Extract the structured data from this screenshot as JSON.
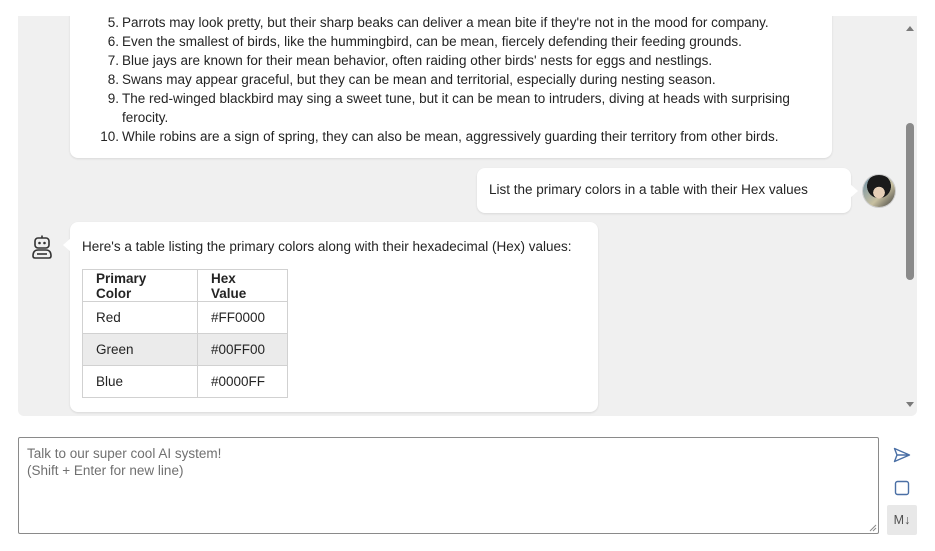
{
  "chat": {
    "list_items": [
      {
        "num": "5.",
        "text": "Parrots may look pretty, but their sharp beaks can deliver a mean bite if they're not in the mood for company."
      },
      {
        "num": "6.",
        "text": "Even the smallest of birds, like the hummingbird, can be mean, fiercely defending their feeding grounds."
      },
      {
        "num": "7.",
        "text": "Blue jays are known for their mean behavior, often raiding other birds' nests for eggs and nestlings."
      },
      {
        "num": "8.",
        "text": "Swans may appear graceful, but they can be mean and territorial, especially during nesting season."
      },
      {
        "num": "9.",
        "text": "The red-winged blackbird may sing a sweet tune, but it can be mean to intruders, diving at heads with surprising ferocity."
      },
      {
        "num": "10.",
        "text": "While robins are a sign of spring, they can also be mean, aggressively guarding their territory from other birds."
      }
    ],
    "user_message": "List the primary colors in a table with their Hex values",
    "bot_intro": "Here's a table listing the primary colors along with their hexadecimal (Hex) values:",
    "table": {
      "headers": [
        "Primary Color",
        "Hex Value"
      ],
      "rows": [
        [
          "Red",
          "#FF0000"
        ],
        [
          "Green",
          "#00FF00"
        ],
        [
          "Blue",
          "#0000FF"
        ]
      ]
    }
  },
  "input": {
    "placeholder": "Talk to our super cool AI system!\n(Shift + Enter for new line)",
    "value": ""
  },
  "buttons": {
    "markdown_label": "M↓"
  },
  "colors": {
    "chat_background": "#f0f0f0",
    "bubble_background": "#ffffff",
    "send_icon": "#4a6fa5"
  },
  "icons": {
    "send": "send-icon",
    "stop": "stop-icon",
    "bot": "bot-icon",
    "avatar": "user-avatar"
  }
}
